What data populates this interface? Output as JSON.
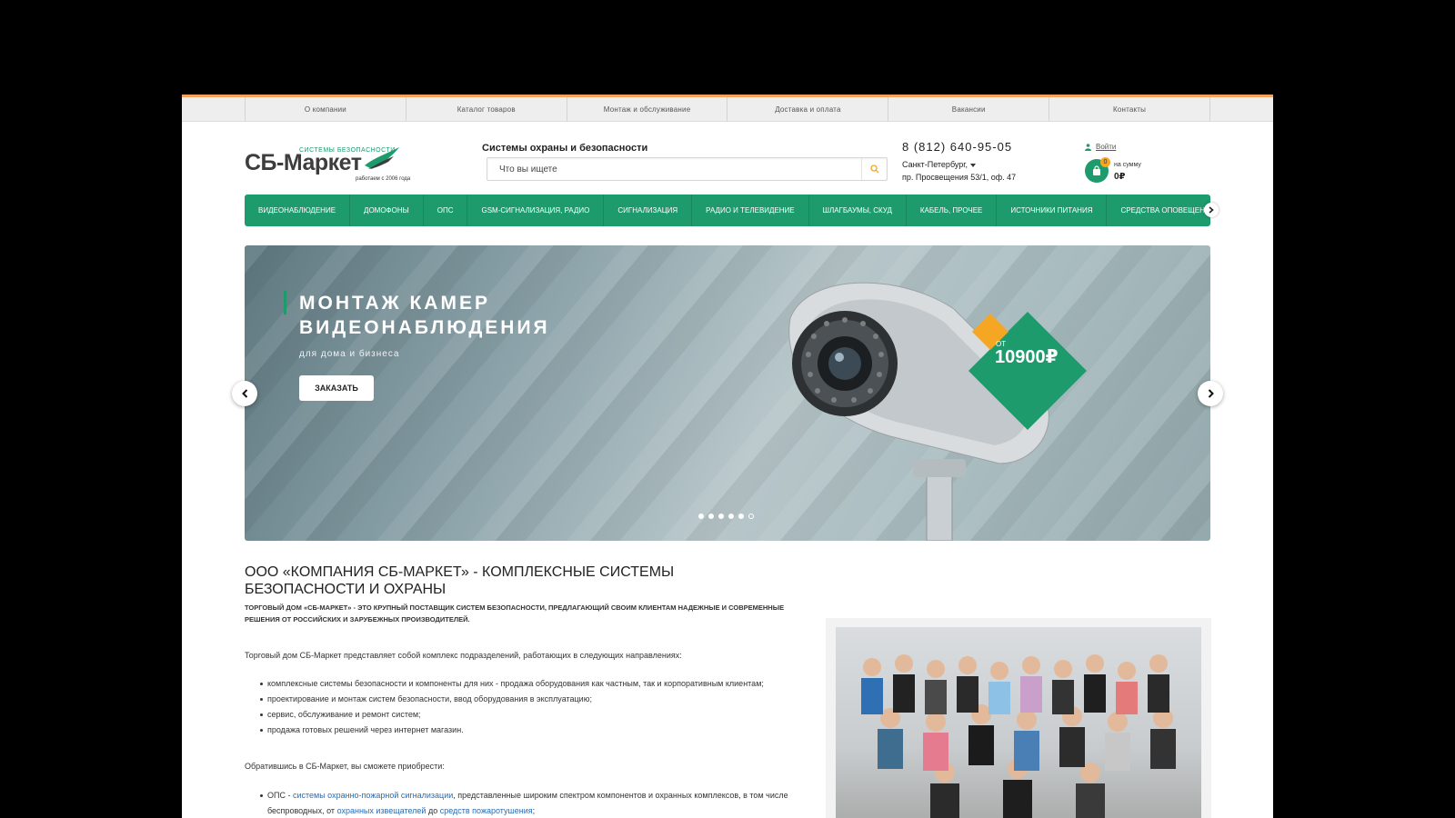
{
  "topnav": {
    "items": [
      {
        "label": "О компании"
      },
      {
        "label": "Каталог товаров"
      },
      {
        "label": "Монтаж и обслуживание"
      },
      {
        "label": "Доставка и оплата"
      },
      {
        "label": "Вакансии"
      },
      {
        "label": "Контакты"
      }
    ]
  },
  "header": {
    "logo_main": "СБ-Маркет",
    "logo_top": "СИСТЕМЫ БЕЗОПАСНОСТИ",
    "logo_sub": "работаем с 2006 года",
    "tagline": "Системы охраны и безопасности",
    "search_placeholder": "Что вы ищете",
    "phone": "8 (812) 640-95-05",
    "city": "Санкт-Петербург,",
    "address": "пр. Просвещения 53/1, оф. 47",
    "login": "Войти",
    "cart_count": "0",
    "cart_label": "на сумму",
    "cart_sum": "0₽"
  },
  "catalog_nav": {
    "items": [
      {
        "label": "Видеонаблюдение"
      },
      {
        "label": "Домофоны"
      },
      {
        "label": "ОПС"
      },
      {
        "label": "GSM-сигнализация, радио"
      },
      {
        "label": "Сигнализация"
      },
      {
        "label": "Радио и телевидение"
      },
      {
        "label": "Шлагбаумы, СКУД"
      },
      {
        "label": "Кабель, прочее"
      },
      {
        "label": "Источники питания"
      },
      {
        "label": "Средства оповещения"
      }
    ]
  },
  "banner": {
    "title": "МОНТАЖ КАМЕР ВИДЕОНАБЛЮДЕНИЯ",
    "subtitle": "для дома и бизнеса",
    "button": "ЗАКАЗАТЬ",
    "price_from": "ОТ",
    "price": "10900₽",
    "slides_total": 6,
    "active_slide": 1,
    "colors": {
      "accent": "#1d9b6c",
      "tag_orange": "#f5a623"
    }
  },
  "content": {
    "title": "ООО «КОМПАНИЯ СБ-МАРКЕТ» - КОМПЛЕКСНЫЕ СИСТЕМЫ БЕЗОПАСНОСТИ И ОХРАНЫ",
    "lead": "Торговый дом «СБ-Маркет» - это крупный поставщик систем безопасности, предлагающий своим клиентам надежные и современные решения от российских и зарубежных производителей.",
    "intro": "Торговый дом СБ-Маркет представляет собой комплекс подразделений, работающих в следующих направлениях:",
    "directions": [
      "комплексные системы безопасности и компоненты для них - продажа оборудования как частным, так и корпоративным клиентам;",
      "проектирование и монтаж систем безопасности, ввод оборудования в эксплуатацию;",
      "сервис, обслуживание и ремонт систем;",
      "продажа готовых решений через интернет магазин."
    ],
    "offer_intro": "Обратившись в СБ-Маркет, вы сможете приобрести:",
    "ops_prefix": "ОПС - ",
    "ops_link1": "системы охранно-пожарной сигнализации",
    "ops_text1": ", представленные широким спектром компонентов и охранных комплексов, в том числе беспроводных, от ",
    "ops_link2": "охранных извещателей",
    "ops_text2": " до ",
    "ops_link3": "средств пожаротушения",
    "ops_text3": ";"
  },
  "colors": {
    "brand_green": "#1d9b6c",
    "top_orange": "#f5a25b",
    "link_blue": "#2b6cb0"
  }
}
